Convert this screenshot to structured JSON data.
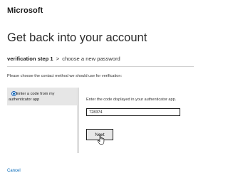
{
  "brand": "Microsoft",
  "title": "Get back into your account",
  "steps": {
    "current": "verification step 1",
    "separator": ">",
    "next": "choose a new password"
  },
  "instruction": "Please choose the contact method we should use for verification:",
  "method": {
    "label_line1": "Enter a code from my",
    "label_line2": "authenticator app",
    "selected": true
  },
  "code_entry": {
    "instruction": "Enter the code displayed in your authenticator app.",
    "value": "728374"
  },
  "buttons": {
    "next": "Next"
  },
  "links": {
    "cancel": "Cancel"
  },
  "colors": {
    "accent": "#0067b8",
    "panel": "#e6e6e6"
  },
  "icons": {
    "cursor": "hand-pointer-icon",
    "radio": "radio-selected-icon"
  }
}
